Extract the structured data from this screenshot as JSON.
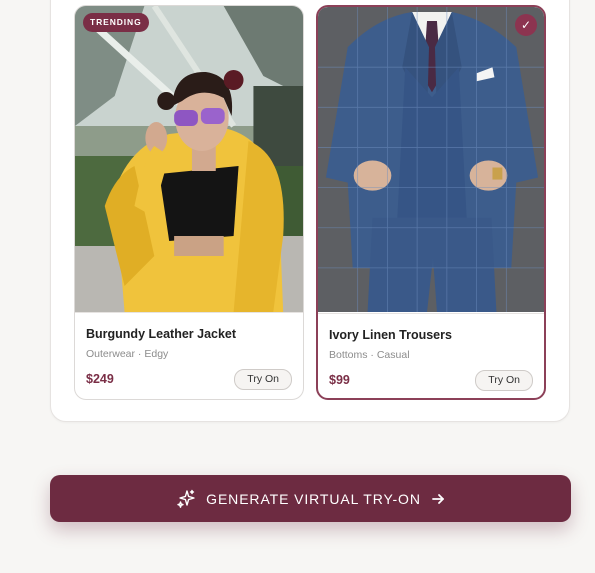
{
  "products": [
    {
      "name": "Burgundy Leather Jacket",
      "meta": "Outerwear · Edgy",
      "price": "$249",
      "try_label": "Try On",
      "badge": "TRENDING",
      "image_icon": "fashion-photo-yellow-puffer",
      "selected": false
    },
    {
      "name": "Ivory Linen Trousers",
      "meta": "Bottoms · Casual",
      "price": "$99",
      "try_label": "Try On",
      "check": "✓",
      "image_icon": "fashion-photo-blue-suit",
      "selected": true
    }
  ],
  "generate_button": {
    "label": "GENERATE VIRTUAL TRY-ON",
    "icon": "sparkles-icon",
    "arrow_icon": "arrow-right-icon"
  },
  "colors": {
    "accent": "#7a2e46",
    "button": "#6d2b41",
    "background": "#f7f6f4"
  }
}
